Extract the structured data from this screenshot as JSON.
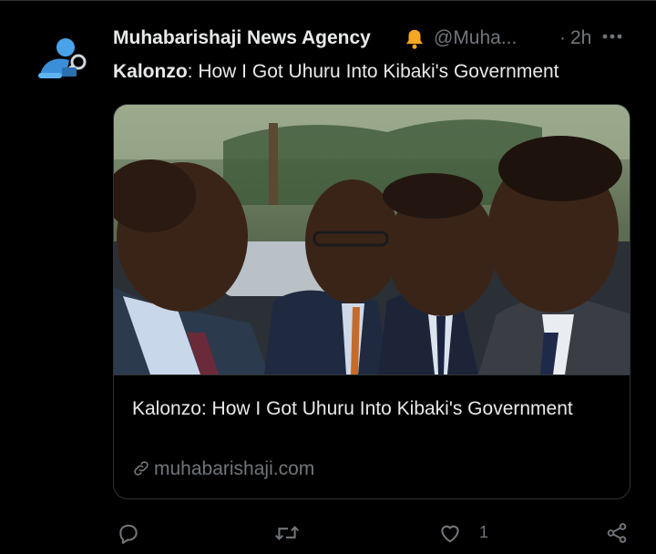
{
  "tweet": {
    "author_name": "Muhabarishaji News Agency",
    "handle": "@Muha...",
    "separator": "·",
    "time": "2h",
    "text_bold": "Kalonzo",
    "text_rest": ": How I Got Uhuru Into Kibaki's Government"
  },
  "card": {
    "title": "Kalonzo: How I Got Uhuru Into Kibaki's Government",
    "domain": "muhabarishaji.com"
  },
  "actions": {
    "reply_count": "",
    "retweet_count": "",
    "like_count": "1"
  },
  "icons": {
    "verified_badge": "bell-icon",
    "more": "more-icon",
    "reply": "reply-icon",
    "retweet": "retweet-icon",
    "like": "heart-icon",
    "share": "share-icon",
    "link": "link-icon"
  },
  "colors": {
    "background": "#000000",
    "text": "#e7e9ea",
    "muted": "#71767b",
    "border": "#2f3336",
    "bell": "#f5a623"
  }
}
